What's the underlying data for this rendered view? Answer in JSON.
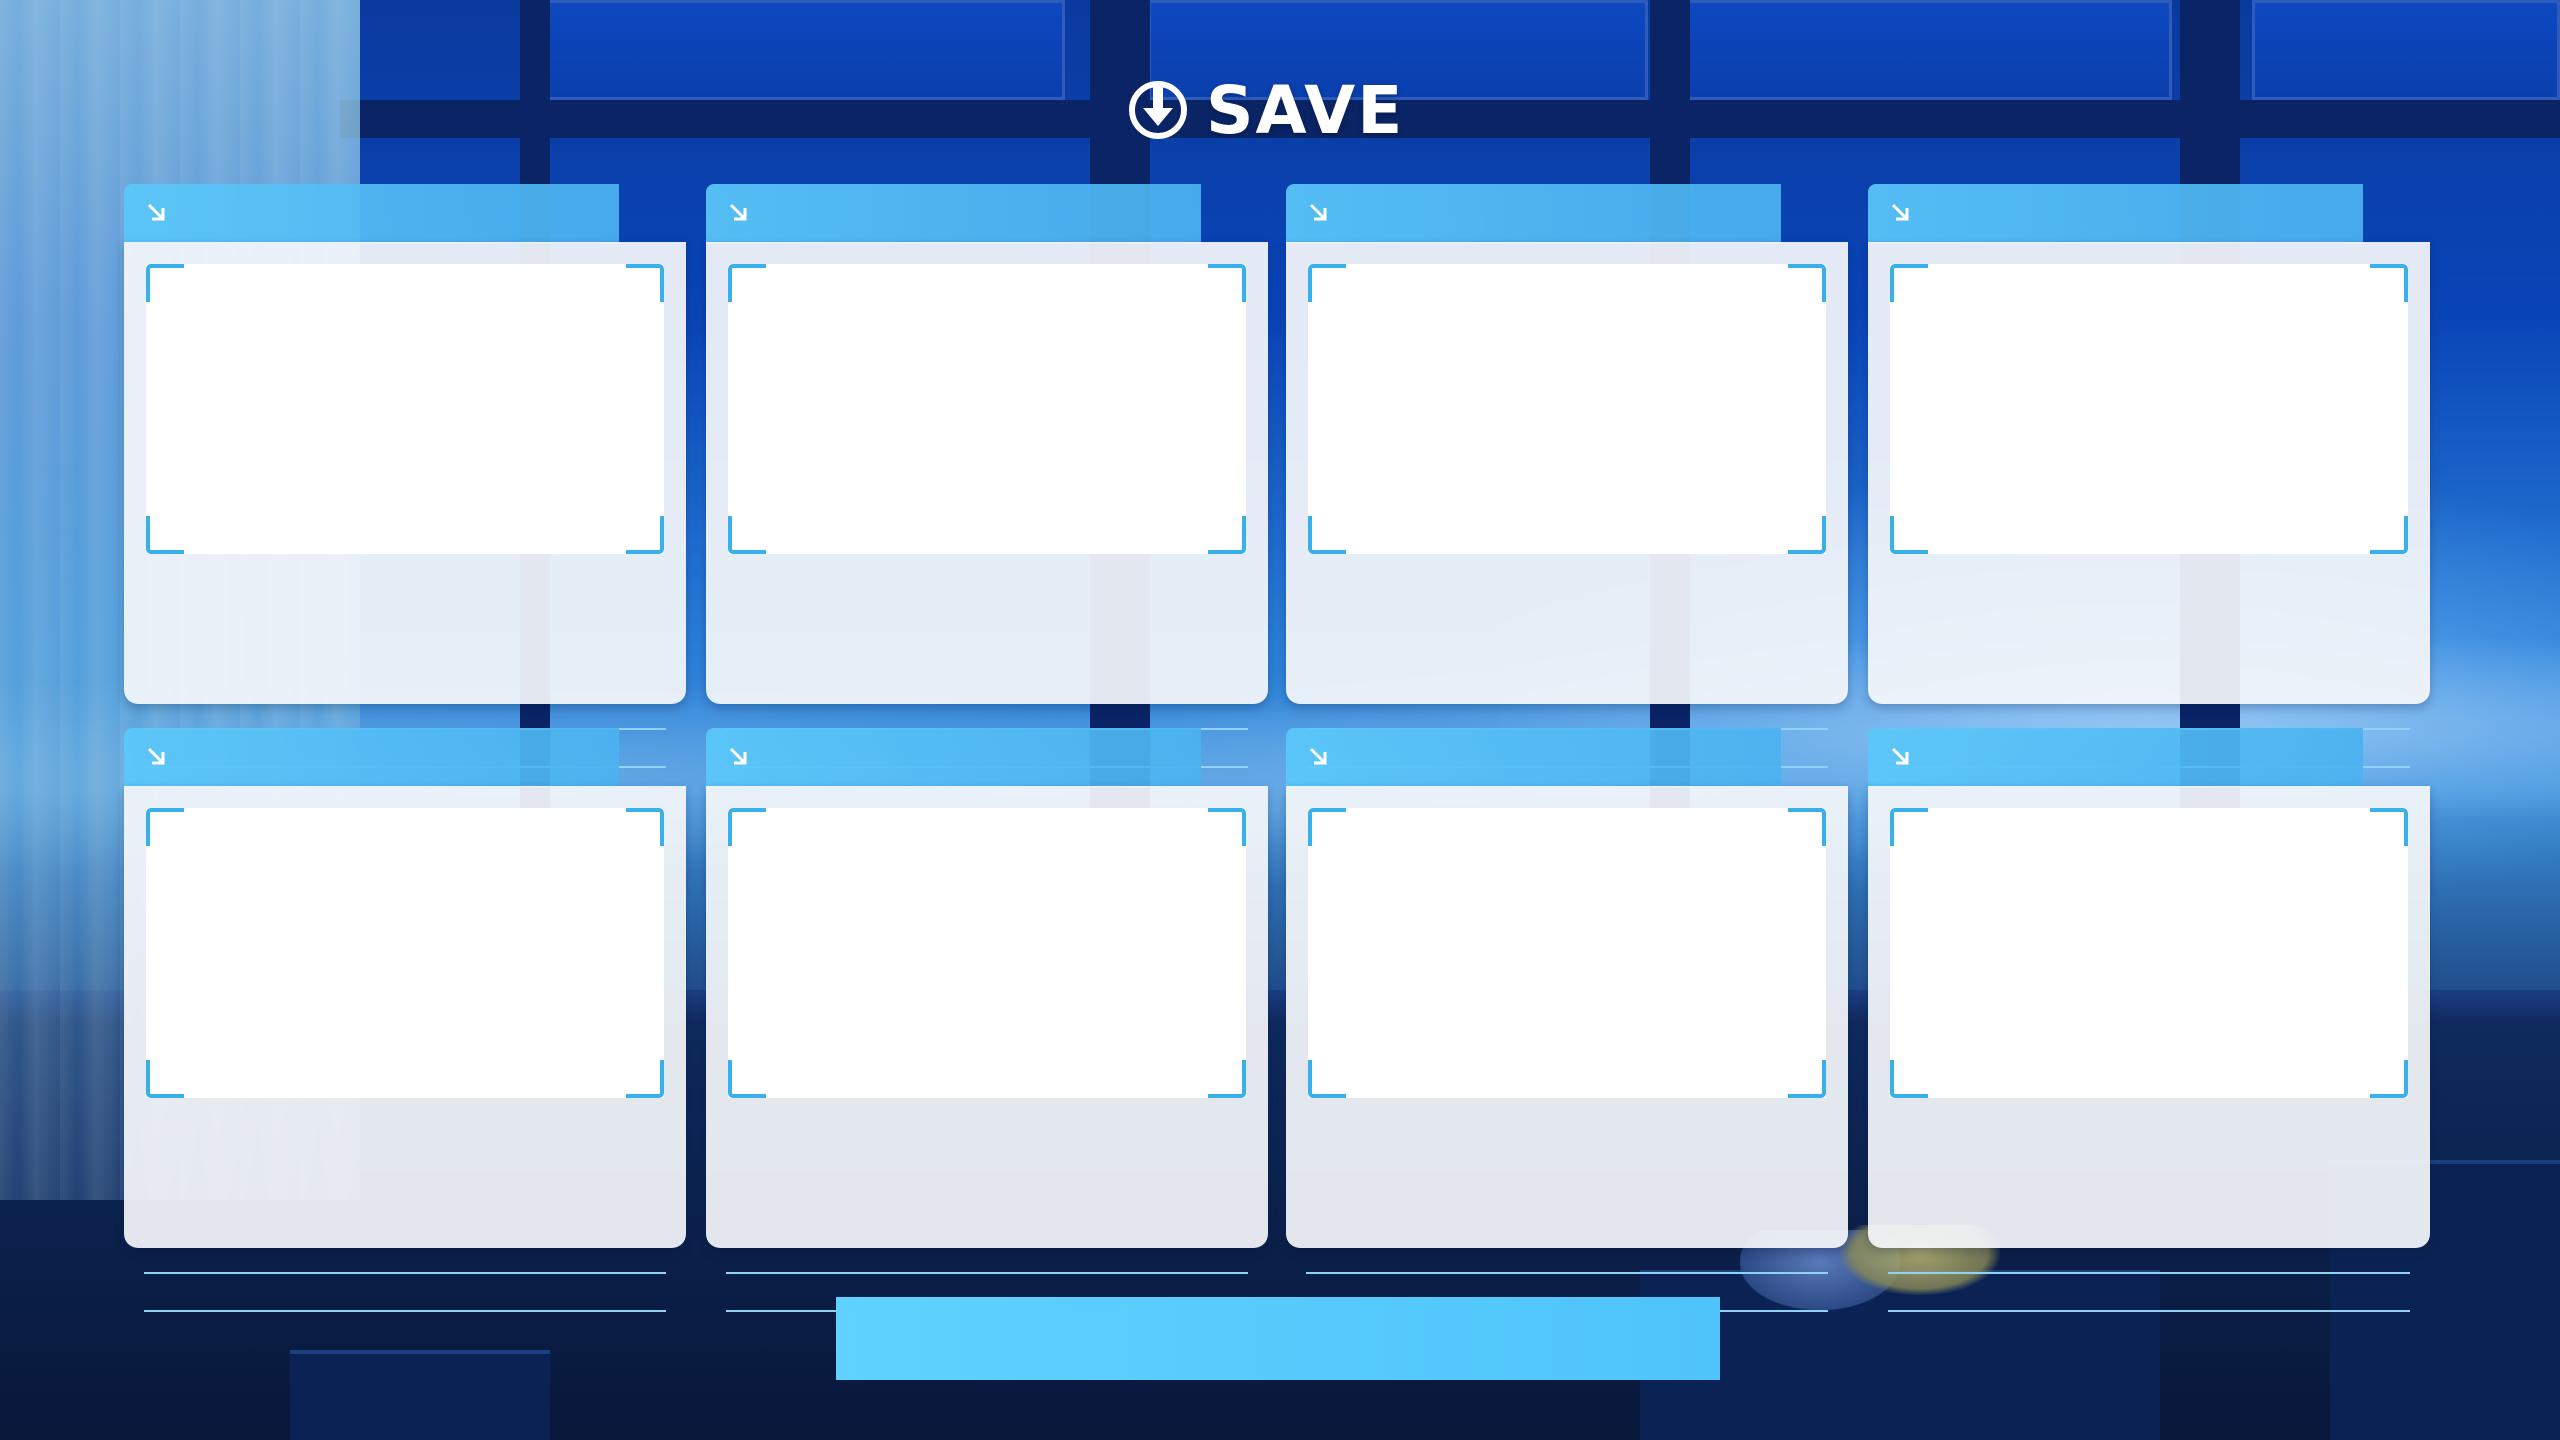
{
  "screen": {
    "title": "SAVE",
    "title_icon": "download-circle-icon",
    "accent_color": "#4fc4fa",
    "tab_color": "#5ac8fa",
    "card_color": "#f4f6fa"
  },
  "slots": [
    {
      "icon": "arrow-down-right-icon",
      "line1": "",
      "line2": ""
    },
    {
      "icon": "arrow-down-right-icon",
      "line1": "",
      "line2": ""
    },
    {
      "icon": "arrow-down-right-icon",
      "line1": "",
      "line2": ""
    },
    {
      "icon": "arrow-down-right-icon",
      "line1": "",
      "line2": ""
    },
    {
      "icon": "arrow-down-right-icon",
      "line1": "",
      "line2": ""
    },
    {
      "icon": "arrow-down-right-icon",
      "line1": "",
      "line2": ""
    },
    {
      "icon": "arrow-down-right-icon",
      "line1": "",
      "line2": ""
    },
    {
      "icon": "arrow-down-right-icon",
      "line1": "",
      "line2": ""
    }
  ],
  "footer": {
    "bar_label": ""
  }
}
